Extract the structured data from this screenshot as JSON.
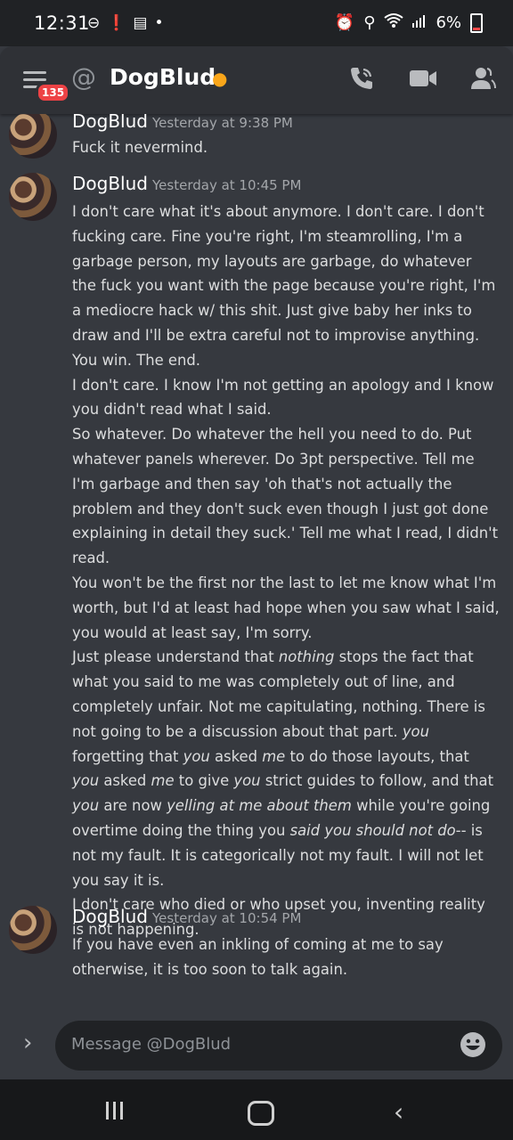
{
  "status_bar": {
    "time": "12:31",
    "battery": "6%"
  },
  "header": {
    "unread_badge": "135",
    "at_symbol": "@",
    "channel_name": "DogBlud",
    "status_icon": "moon-icon"
  },
  "messages": [
    {
      "author": "DogBlud",
      "timestamp": "Yesterday at 9:38 PM",
      "paragraphs": [
        "Fuck it nevermind."
      ]
    },
    {
      "author": "DogBlud",
      "timestamp": "Yesterday at 10:45 PM",
      "paragraphs": [
        "I don't care what it's about anymore. I don't care. I don't fucking care. Fine you're right, I'm steamrolling, I'm a garbage person, my layouts are garbage, do whatever the fuck you want with the page because you're right, I'm a mediocre hack w/ this shit. Just give baby her inks to draw and I'll be extra careful not to improvise anything. You win. The end.",
        "I don't care. I know I'm not getting an apology and I know you didn't read what I said.",
        "So whatever. Do whatever the hell you need to do. Put whatever panels wherever. Do 3pt perspective. Tell me I'm garbage and then say 'oh that's not actually the problem and they don't suck even though I just got done explaining in detail they suck.' Tell me what I read, I didn't read.",
        "You won't be the first nor the last to let me know what I'm worth, but I'd at least had hope when you saw what I said, you would at least say, I'm sorry.",
        "Just please understand that <em>nothing</em> stops the fact that what you said to me was completely out of line, and completely unfair. Not me capitulating, nothing. There is not going to be a discussion about that part. <em>you</em> forgetting that <em>you</em> asked <em>me</em> to do those layouts, that <em>you</em> asked <em>me</em> to give <em>you</em> strict guides to follow, and that <em>you</em> are now <em>yelling at me about them</em> while you're going overtime doing the thing you <em>said you should not do</em>-- is not my fault. It is categorically not my fault. I will not let you say it is.",
        "I don't care who died or who upset you, inventing reality is not happening."
      ]
    },
    {
      "author": "DogBlud",
      "timestamp": "Yesterday at 10:54 PM",
      "paragraphs": [
        "If you have even an inkling of coming at me to say otherwise, it is too soon to talk again."
      ]
    }
  ],
  "composer": {
    "placeholder": "Message @DogBlud"
  },
  "colors": {
    "background": "#36393f",
    "header": "#2f3136",
    "badge": "#ed4245",
    "status_idle": "#faa61a"
  }
}
